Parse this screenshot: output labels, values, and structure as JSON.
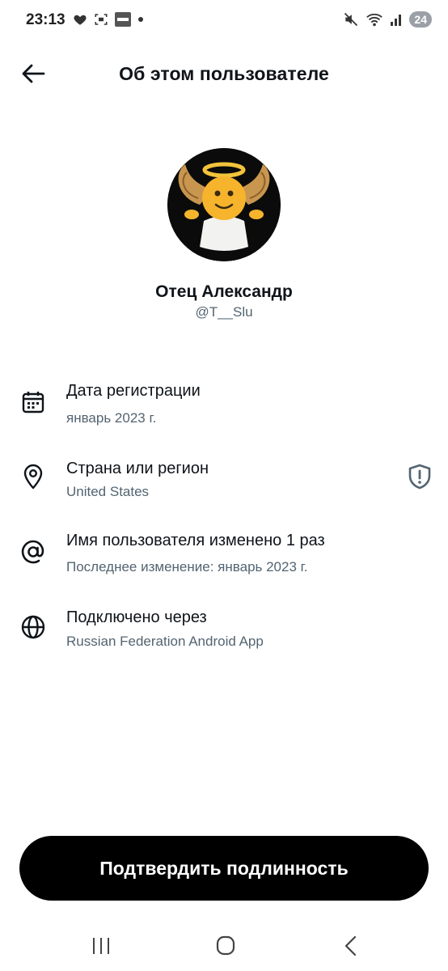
{
  "status_bar": {
    "time": "23:13",
    "left_icons": [
      "heart-icon",
      "screenshot-icon",
      "bybit-icon",
      "dot-icon"
    ],
    "right_icons": [
      "mute-icon",
      "wifi-icon",
      "signal-icon"
    ],
    "battery": "24"
  },
  "header": {
    "title": "Об этом пользователе"
  },
  "profile": {
    "name": "Отец Александр",
    "handle": "@T__Slu"
  },
  "info": {
    "registration": {
      "title": "Дата регистрации",
      "subtitle": "январь 2023 г."
    },
    "country": {
      "title": "Страна или регион",
      "subtitle": "United States"
    },
    "username": {
      "title": "Имя пользователя изменено 1 раз",
      "subtitle": "Последнее изменение: январь 2023 г."
    },
    "connected": {
      "title": "Подключено через",
      "subtitle": "Russian Federation Android App"
    }
  },
  "verify_button": {
    "label": "Подтвердить подлинность"
  },
  "colors": {
    "text_primary": "#0f1419",
    "text_secondary": "#536471",
    "button_bg": "#000000",
    "button_text": "#ffffff"
  }
}
